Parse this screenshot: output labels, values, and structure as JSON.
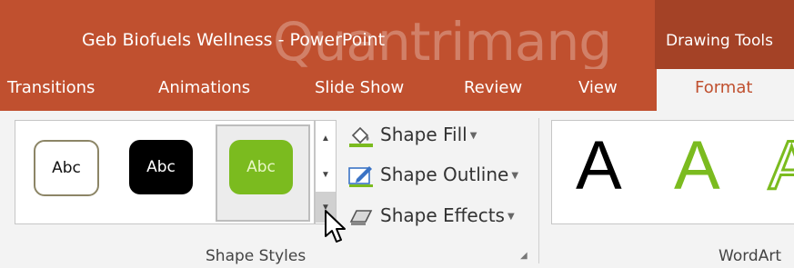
{
  "window": {
    "title": "Geb Biofuels Wellness - PowerPoint"
  },
  "context_tab_group": {
    "label": "Drawing Tools"
  },
  "tabs": [
    {
      "label": "Transitions"
    },
    {
      "label": "Animations"
    },
    {
      "label": "Slide Show"
    },
    {
      "label": "Review"
    },
    {
      "label": "View"
    },
    {
      "label": "Format",
      "active": true
    }
  ],
  "shape_styles": {
    "group_label": "Shape Styles",
    "swatches": [
      {
        "text": "Abc",
        "style": "white fill, olive outline"
      },
      {
        "text": "Abc",
        "style": "black fill"
      },
      {
        "text": "Abc",
        "style": "green fill",
        "selected": true
      }
    ],
    "commands": [
      {
        "label": "Shape Fill",
        "icon": "paint-bucket-icon"
      },
      {
        "label": "Shape Outline",
        "icon": "pencil-outline-icon"
      },
      {
        "label": "Shape Effects",
        "icon": "shape-effects-icon"
      }
    ]
  },
  "wordart": {
    "group_label": "WordArt",
    "samples": [
      {
        "text": "A",
        "color": "#000000"
      },
      {
        "text": "A",
        "color": "#7bbb1f"
      },
      {
        "text": "A",
        "color": "#7bbb1f",
        "outline": true
      }
    ]
  },
  "colors": {
    "ribbon_accent": "#c0502f",
    "green": "#7bbb1f"
  },
  "watermark": "Quantrimang"
}
